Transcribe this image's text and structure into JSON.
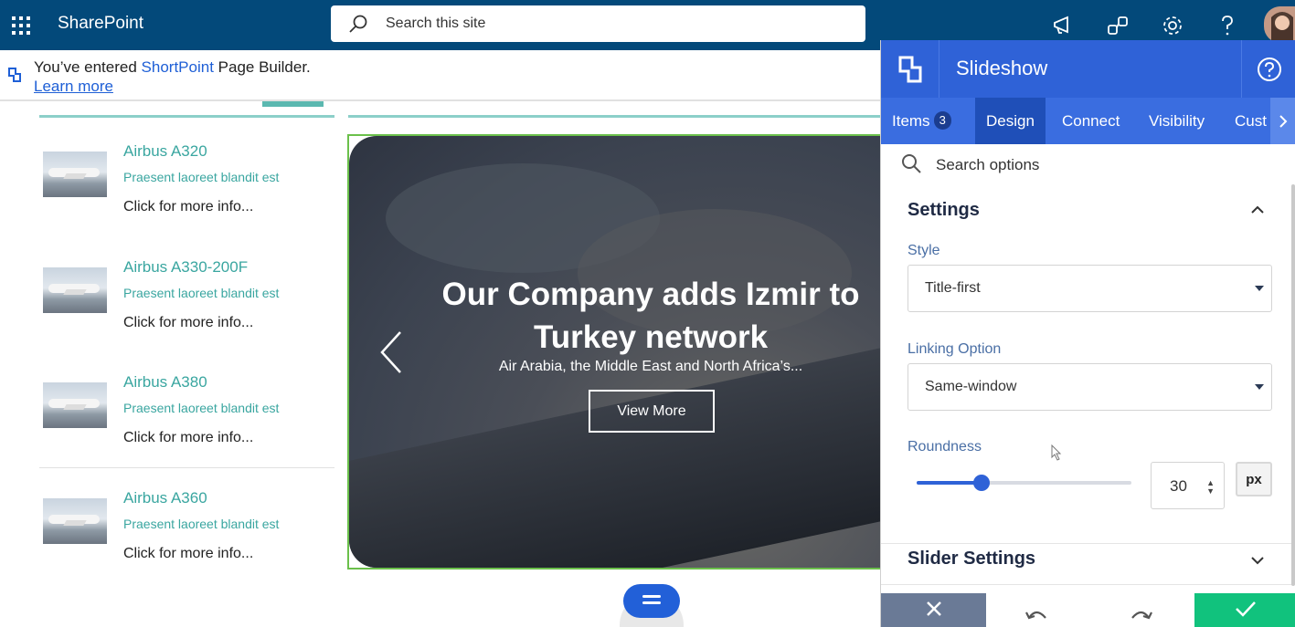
{
  "suitebar": {
    "app_title": "SharePoint",
    "search_placeholder": "Search this site",
    "icons": [
      "waffle-icon",
      "search-icon",
      "megaphone-icon",
      "people-icon",
      "gear-icon",
      "help-icon",
      "avatar"
    ]
  },
  "notice": {
    "prefix": "You’ve entered ",
    "brand": "ShortPoint",
    "suffix": " Page Builder.",
    "link": "Learn more"
  },
  "list": {
    "items": [
      {
        "title": "Airbus A320",
        "subtitle": "Praesent laoreet blandit est",
        "link": "Click for more info..."
      },
      {
        "title": "Airbus A330-200F",
        "subtitle": "Praesent laoreet blandit est",
        "link": "Click for more info..."
      },
      {
        "title": "Airbus A380",
        "subtitle": "Praesent laoreet blandit est",
        "link": "Click for more info..."
      },
      {
        "title": "Airbus A360",
        "subtitle": "Praesent laoreet blandit est",
        "link": "Click for more info..."
      }
    ]
  },
  "slide": {
    "title": "Our Company adds Izmir to Turkey network",
    "subtitle": "Air Arabia, the Middle East and North Africa’s...",
    "button": "View More"
  },
  "panel": {
    "title": "Slideshow",
    "tabs": [
      {
        "label": "Items",
        "badge": "3"
      },
      {
        "label": "Design"
      },
      {
        "label": "Connect"
      },
      {
        "label": "Visibility"
      },
      {
        "label": "Cust"
      }
    ],
    "active_tab": "Design",
    "search_placeholder": "Search options",
    "settings_heading": "Settings",
    "style_label": "Style",
    "style_value": "Title-first",
    "linking_label": "Linking Option",
    "linking_value": "Same-window",
    "roundness_label": "Roundness",
    "roundness_value": "30",
    "roundness_slider_fraction": 0.3,
    "roundness_unit": "px",
    "slider_settings_heading": "Slider Settings"
  },
  "colors": {
    "suitebar": "#03497a",
    "panel_header": "#2f62d7",
    "accent_teal": "#3aa6a0",
    "apply_green": "#11c27d",
    "slide_border": "#6bc04b"
  }
}
